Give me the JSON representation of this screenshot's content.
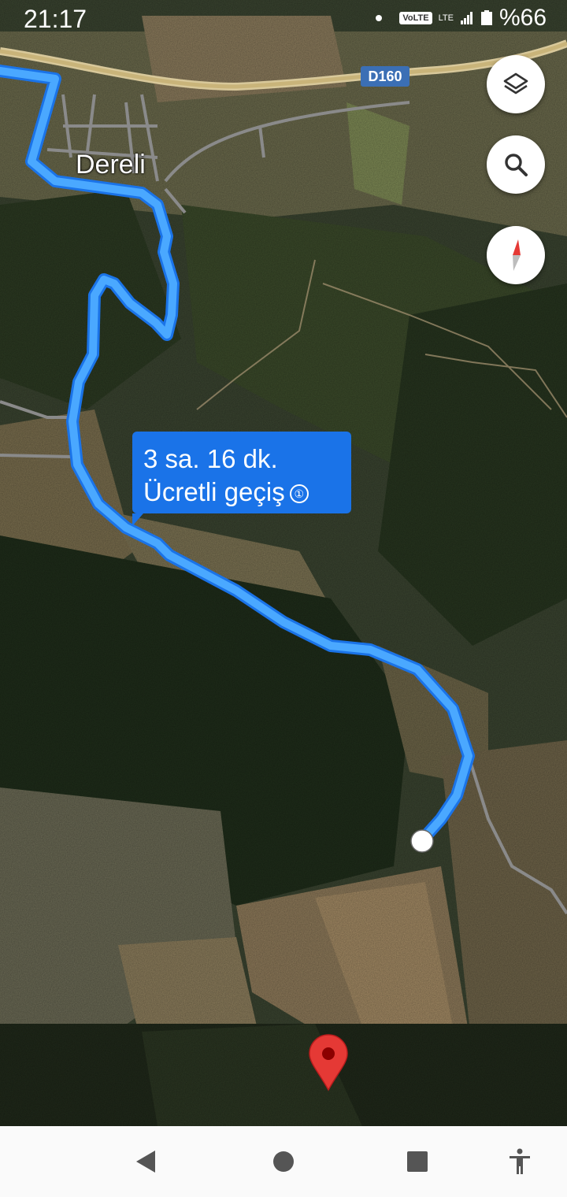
{
  "status_bar": {
    "time": "21:17",
    "network_badge": "VoLTE",
    "network_type": "LTE",
    "battery": "%66"
  },
  "map": {
    "place_label": "Dereli",
    "road_badge": "D160"
  },
  "route_tooltip": {
    "duration": "3 sa. 16 dk.",
    "note": "Ücretli geçiş",
    "note_icon": "①"
  },
  "controls": {
    "layers_icon": "layers-icon",
    "search_icon": "search-icon",
    "compass_icon": "compass-icon"
  },
  "navigation_bar": {
    "back_icon": "back-icon",
    "home_icon": "home-icon",
    "recents_icon": "recents-icon",
    "accessibility_icon": "accessibility-icon"
  },
  "colors": {
    "route": "#4aa8ff",
    "route_outline": "#1a73e8",
    "tooltip": "#1a73e8",
    "pin": "#e53935"
  }
}
